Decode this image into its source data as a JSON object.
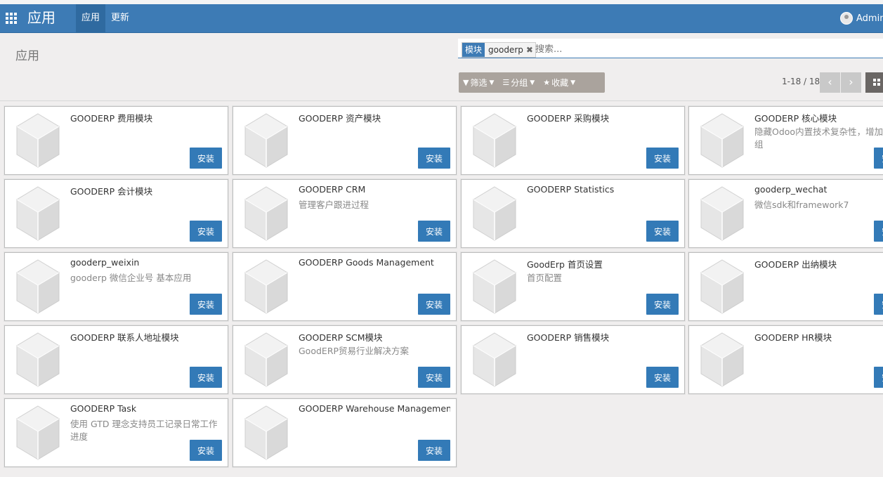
{
  "navbar": {
    "brand": "应用",
    "menu": [
      "应用",
      "更新"
    ],
    "user": "Admini"
  },
  "control": {
    "title": "应用",
    "facet_category": "模块",
    "facet_value": "gooderp",
    "search_placeholder": "搜索...",
    "filters_label": "筛选",
    "groupby_label": "分组",
    "favorites_label": "收藏",
    "pager": "1-18 / 18"
  },
  "colors": {
    "navbar": "#3d7bb5",
    "install_button": "#337ab7",
    "background": "#f0eeee",
    "filter_group": "#aaa39d"
  },
  "install_label": "安装",
  "modules": [
    {
      "name": "GOODERP 费用模块",
      "summary": ""
    },
    {
      "name": "GOODERP 资产模块",
      "summary": ""
    },
    {
      "name": "GOODERP 采购模块",
      "summary": ""
    },
    {
      "name": "GOODERP 核心模块",
      "summary": "隐藏Odoo内置技术复杂性，增加权限组"
    },
    {
      "name": "GOODERP 会计模块",
      "summary": ""
    },
    {
      "name": "GOODERP CRM",
      "summary": "管理客户跟进过程"
    },
    {
      "name": "GOODERP Statistics",
      "summary": ""
    },
    {
      "name": "gooderp_wechat",
      "summary": "微信sdk和framework7"
    },
    {
      "name": "gooderp_weixin",
      "summary": "gooderp 微信企业号 基本应用"
    },
    {
      "name": "GOODERP Goods Management",
      "summary": ""
    },
    {
      "name": "GoodErp 首页设置",
      "summary": "首页配置"
    },
    {
      "name": "GOODERP 出纳模块",
      "summary": ""
    },
    {
      "name": "GOODERP 联系人地址模块",
      "summary": ""
    },
    {
      "name": "GOODERP SCM模块",
      "summary": "GoodERP贸易行业解决方案"
    },
    {
      "name": "GOODERP 销售模块",
      "summary": ""
    },
    {
      "name": "GOODERP HR模块",
      "summary": ""
    },
    {
      "name": "GOODERP Task",
      "summary": "使用 GTD 理念支持员工记录日常工作进度"
    },
    {
      "name": "GOODERP Warehouse Management",
      "summary": ""
    }
  ]
}
